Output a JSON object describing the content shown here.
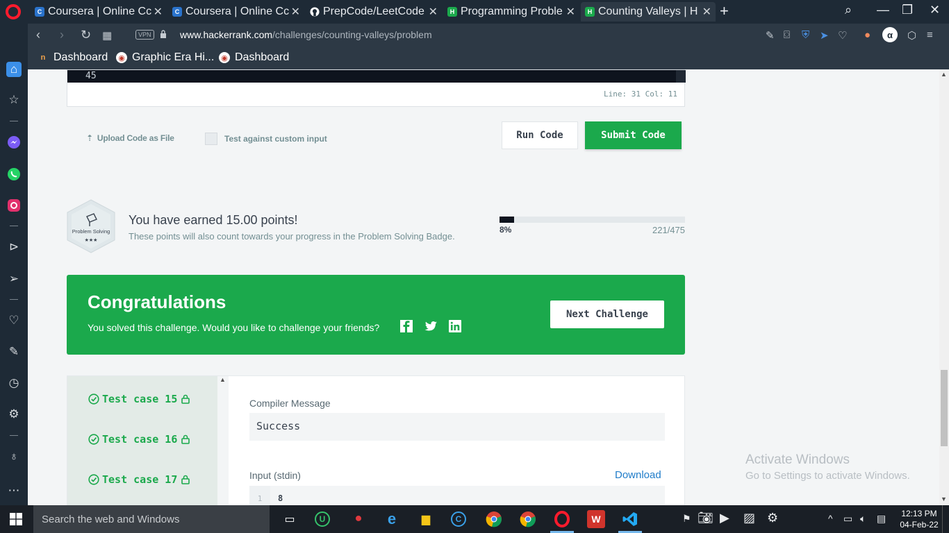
{
  "browser": {
    "tabs": [
      {
        "title": "Coursera | Online Cc",
        "fav": "C",
        "color": "#2a73cc"
      },
      {
        "title": "Coursera | Online Cc",
        "fav": "C",
        "color": "#2a73cc"
      },
      {
        "title": "PrepCode/LeetCode",
        "fav": "",
        "color": "#ffffff"
      },
      {
        "title": "Programming Proble",
        "fav": "H",
        "color": "#1ba94c"
      },
      {
        "title": "Counting Valleys | H",
        "fav": "H",
        "color": "#1ba94c"
      }
    ],
    "address": {
      "vpn": "VPN",
      "url_domain": "www.hackerrank.com",
      "url_path": "/challenges/counting-valleys/problem"
    },
    "bookmarks": [
      {
        "label": "Dashboard"
      },
      {
        "label": "Graphic Era Hi..."
      },
      {
        "label": "Dashboard"
      }
    ]
  },
  "editor": {
    "visible_line": "45",
    "status": "Line: 31 Col: 11"
  },
  "actions": {
    "upload_label": "Upload Code as File",
    "custom_input_label": "Test against custom input",
    "run_label": "Run Code",
    "submit_label": "Submit Code"
  },
  "points": {
    "badge_name": "Problem Solving",
    "badge_stars": "★★★",
    "title": "You have earned 15.00 points!",
    "subtitle": "These points will also count towards your progress in the Problem Solving Badge.",
    "progress_percent": 8,
    "progress_label": "8%",
    "progress_count": "221/475"
  },
  "congrats": {
    "title": "Congratulations",
    "subtitle": "You solved this challenge. Would you like to challenge your friends?",
    "next_label": "Next Challenge",
    "accent": "#1ba94c"
  },
  "test_cases": {
    "items": [
      {
        "label": "Test case 15"
      },
      {
        "label": "Test case 16"
      },
      {
        "label": "Test case 17"
      }
    ],
    "compiler_label": "Compiler Message",
    "compiler_message": "Success",
    "stdin_label": "Input (stdin)",
    "download_label": "Download",
    "stdin_line_number": "1",
    "stdin_first_line": "8"
  },
  "watermark": {
    "line1": "Activate Windows",
    "line2": "Go to Settings to activate Windows."
  },
  "taskbar": {
    "search_placeholder": "Search the web and Windows",
    "time": "12:13 PM",
    "date": "04-Feb-22"
  }
}
